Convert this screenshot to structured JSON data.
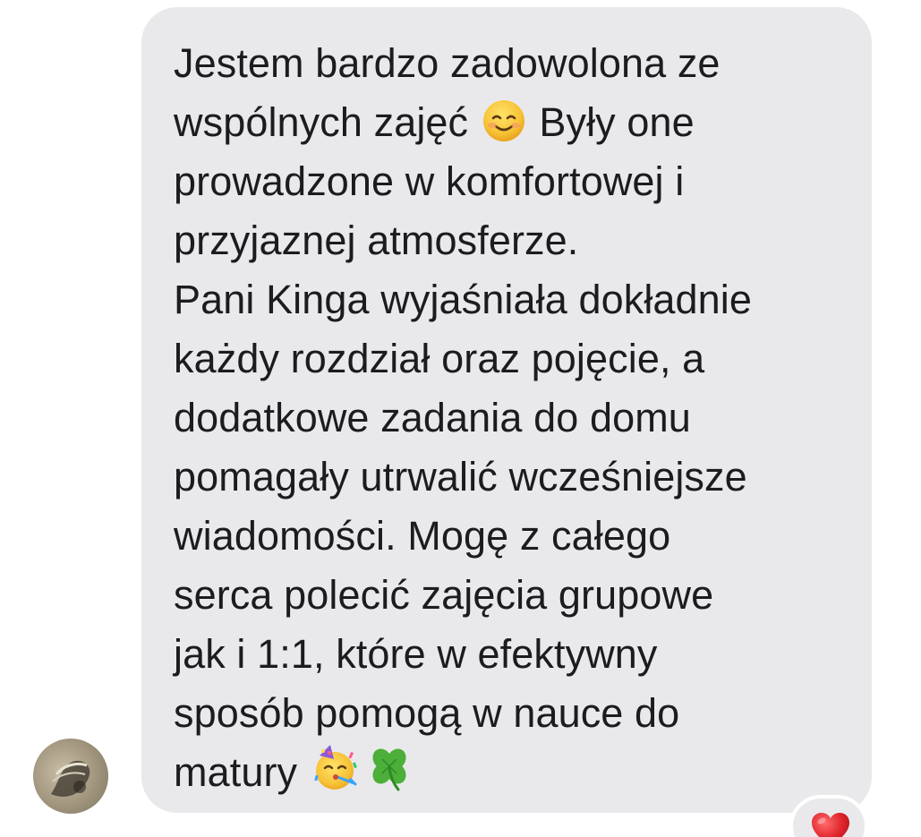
{
  "message": {
    "lines": [
      "Jestem bardzo zadowolona ze",
      "wspólnych zajęć",
      "Były one",
      "prowadzone w komfortowej i",
      "przyjaznej atmosferze.",
      "Pani Kinga wyjaśniała dokładnie",
      "każdy rozdział oraz pojęcie, a",
      "dodatkowe zadania do domu",
      "pomagały utrwalić wcześniejsze",
      "wiadomości. Mogę z całego",
      "serca polecić zajęcia grupowe",
      "jak i 1:1, które w efektywny",
      "sposób pomogą w nauce do",
      "matury"
    ],
    "emojis": {
      "after_line_2": "smiling-face-icon",
      "after_matury": [
        "partying-face-icon",
        "four-leaf-clover-icon"
      ]
    }
  },
  "reaction": {
    "icon": "red-heart-icon",
    "color": "#e0262c"
  },
  "colors": {
    "bubble": "#e9e9eb",
    "text": "#1c1c1e",
    "background": "#ffffff"
  }
}
